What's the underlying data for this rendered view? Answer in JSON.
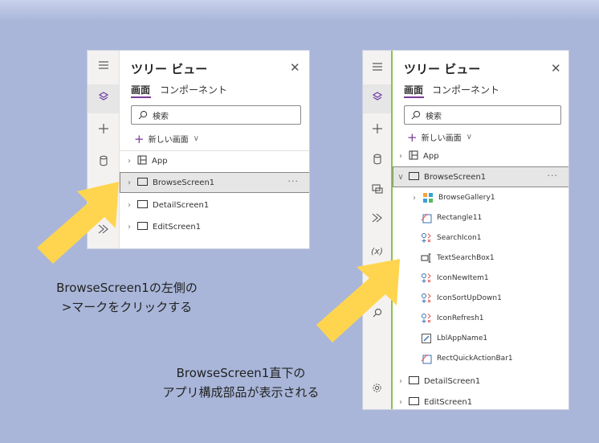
{
  "left_panel": {
    "title": "ツリー ビュー",
    "tabs": [
      "画面",
      "コンポーネント"
    ],
    "search_placeholder": "検索",
    "new_screen_label": "新しい画面",
    "tree": [
      {
        "label": "App",
        "icon": "app-icon"
      },
      {
        "label": "BrowseScreen1",
        "icon": "screen-icon",
        "selected": true,
        "more": "···"
      },
      {
        "label": "DetailScreen1",
        "icon": "screen-icon"
      },
      {
        "label": "EditScreen1",
        "icon": "screen-icon"
      }
    ]
  },
  "right_panel": {
    "title": "ツリー ビュー",
    "tabs": [
      "画面",
      "コンポーネント"
    ],
    "search_placeholder": "検索",
    "new_screen_label": "新しい画面",
    "tree": [
      {
        "label": "App",
        "icon": "app-icon"
      },
      {
        "label": "BrowseScreen1",
        "icon": "screen-icon",
        "selected": true,
        "expanded": true,
        "more": "···"
      },
      {
        "label": "DetailScreen1",
        "icon": "screen-icon"
      },
      {
        "label": "EditScreen1",
        "icon": "screen-icon"
      }
    ],
    "children": [
      {
        "label": "BrowseGallery1",
        "icon": "gallery-icon"
      },
      {
        "label": "Rectangle11",
        "icon": "rectangle-icon"
      },
      {
        "label": "SearchIcon1",
        "icon": "icon-control-icon"
      },
      {
        "label": "TextSearchBox1",
        "icon": "textinput-icon"
      },
      {
        "label": "IconNewItem1",
        "icon": "icon-control-icon"
      },
      {
        "label": "IconSortUpDown1",
        "icon": "icon-control-icon"
      },
      {
        "label": "IconRefresh1",
        "icon": "icon-control-icon"
      },
      {
        "label": "LblAppName1",
        "icon": "label-icon"
      },
      {
        "label": "RectQuickActionBar1",
        "icon": "rectangle-icon"
      }
    ],
    "rail_var_label": "(x)"
  },
  "callouts": {
    "left_line1": "BrowseScreen1の左側の",
    "left_line2": ">マークをクリックする",
    "right_line1": "BrowseScreen1直下の",
    "right_line2": "アプリ構成部品が表示される"
  },
  "colors": {
    "background": "#a9b6d9",
    "arrow": "#ffd54f",
    "accent": "#7a3a98"
  }
}
